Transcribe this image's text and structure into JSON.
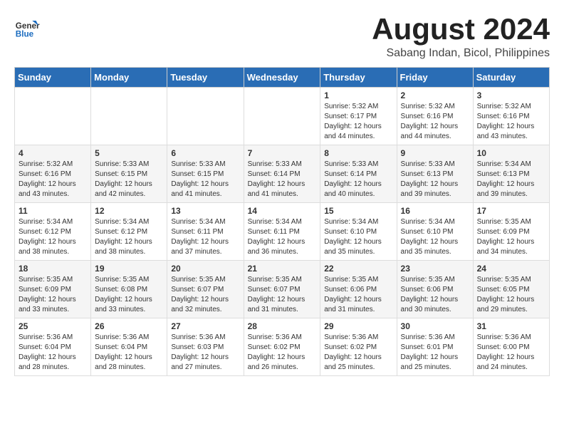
{
  "header": {
    "logo_line1": "General",
    "logo_line2": "Blue",
    "month_year": "August 2024",
    "location": "Sabang Indan, Bicol, Philippines"
  },
  "weekdays": [
    "Sunday",
    "Monday",
    "Tuesday",
    "Wednesday",
    "Thursday",
    "Friday",
    "Saturday"
  ],
  "weeks": [
    [
      {
        "day": "",
        "info": ""
      },
      {
        "day": "",
        "info": ""
      },
      {
        "day": "",
        "info": ""
      },
      {
        "day": "",
        "info": ""
      },
      {
        "day": "1",
        "info": "Sunrise: 5:32 AM\nSunset: 6:17 PM\nDaylight: 12 hours\nand 44 minutes."
      },
      {
        "day": "2",
        "info": "Sunrise: 5:32 AM\nSunset: 6:16 PM\nDaylight: 12 hours\nand 44 minutes."
      },
      {
        "day": "3",
        "info": "Sunrise: 5:32 AM\nSunset: 6:16 PM\nDaylight: 12 hours\nand 43 minutes."
      }
    ],
    [
      {
        "day": "4",
        "info": "Sunrise: 5:32 AM\nSunset: 6:16 PM\nDaylight: 12 hours\nand 43 minutes."
      },
      {
        "day": "5",
        "info": "Sunrise: 5:33 AM\nSunset: 6:15 PM\nDaylight: 12 hours\nand 42 minutes."
      },
      {
        "day": "6",
        "info": "Sunrise: 5:33 AM\nSunset: 6:15 PM\nDaylight: 12 hours\nand 41 minutes."
      },
      {
        "day": "7",
        "info": "Sunrise: 5:33 AM\nSunset: 6:14 PM\nDaylight: 12 hours\nand 41 minutes."
      },
      {
        "day": "8",
        "info": "Sunrise: 5:33 AM\nSunset: 6:14 PM\nDaylight: 12 hours\nand 40 minutes."
      },
      {
        "day": "9",
        "info": "Sunrise: 5:33 AM\nSunset: 6:13 PM\nDaylight: 12 hours\nand 39 minutes."
      },
      {
        "day": "10",
        "info": "Sunrise: 5:34 AM\nSunset: 6:13 PM\nDaylight: 12 hours\nand 39 minutes."
      }
    ],
    [
      {
        "day": "11",
        "info": "Sunrise: 5:34 AM\nSunset: 6:12 PM\nDaylight: 12 hours\nand 38 minutes."
      },
      {
        "day": "12",
        "info": "Sunrise: 5:34 AM\nSunset: 6:12 PM\nDaylight: 12 hours\nand 38 minutes."
      },
      {
        "day": "13",
        "info": "Sunrise: 5:34 AM\nSunset: 6:11 PM\nDaylight: 12 hours\nand 37 minutes."
      },
      {
        "day": "14",
        "info": "Sunrise: 5:34 AM\nSunset: 6:11 PM\nDaylight: 12 hours\nand 36 minutes."
      },
      {
        "day": "15",
        "info": "Sunrise: 5:34 AM\nSunset: 6:10 PM\nDaylight: 12 hours\nand 35 minutes."
      },
      {
        "day": "16",
        "info": "Sunrise: 5:34 AM\nSunset: 6:10 PM\nDaylight: 12 hours\nand 35 minutes."
      },
      {
        "day": "17",
        "info": "Sunrise: 5:35 AM\nSunset: 6:09 PM\nDaylight: 12 hours\nand 34 minutes."
      }
    ],
    [
      {
        "day": "18",
        "info": "Sunrise: 5:35 AM\nSunset: 6:09 PM\nDaylight: 12 hours\nand 33 minutes."
      },
      {
        "day": "19",
        "info": "Sunrise: 5:35 AM\nSunset: 6:08 PM\nDaylight: 12 hours\nand 33 minutes."
      },
      {
        "day": "20",
        "info": "Sunrise: 5:35 AM\nSunset: 6:07 PM\nDaylight: 12 hours\nand 32 minutes."
      },
      {
        "day": "21",
        "info": "Sunrise: 5:35 AM\nSunset: 6:07 PM\nDaylight: 12 hours\nand 31 minutes."
      },
      {
        "day": "22",
        "info": "Sunrise: 5:35 AM\nSunset: 6:06 PM\nDaylight: 12 hours\nand 31 minutes."
      },
      {
        "day": "23",
        "info": "Sunrise: 5:35 AM\nSunset: 6:06 PM\nDaylight: 12 hours\nand 30 minutes."
      },
      {
        "day": "24",
        "info": "Sunrise: 5:35 AM\nSunset: 6:05 PM\nDaylight: 12 hours\nand 29 minutes."
      }
    ],
    [
      {
        "day": "25",
        "info": "Sunrise: 5:36 AM\nSunset: 6:04 PM\nDaylight: 12 hours\nand 28 minutes."
      },
      {
        "day": "26",
        "info": "Sunrise: 5:36 AM\nSunset: 6:04 PM\nDaylight: 12 hours\nand 28 minutes."
      },
      {
        "day": "27",
        "info": "Sunrise: 5:36 AM\nSunset: 6:03 PM\nDaylight: 12 hours\nand 27 minutes."
      },
      {
        "day": "28",
        "info": "Sunrise: 5:36 AM\nSunset: 6:02 PM\nDaylight: 12 hours\nand 26 minutes."
      },
      {
        "day": "29",
        "info": "Sunrise: 5:36 AM\nSunset: 6:02 PM\nDaylight: 12 hours\nand 25 minutes."
      },
      {
        "day": "30",
        "info": "Sunrise: 5:36 AM\nSunset: 6:01 PM\nDaylight: 12 hours\nand 25 minutes."
      },
      {
        "day": "31",
        "info": "Sunrise: 5:36 AM\nSunset: 6:00 PM\nDaylight: 12 hours\nand 24 minutes."
      }
    ]
  ]
}
